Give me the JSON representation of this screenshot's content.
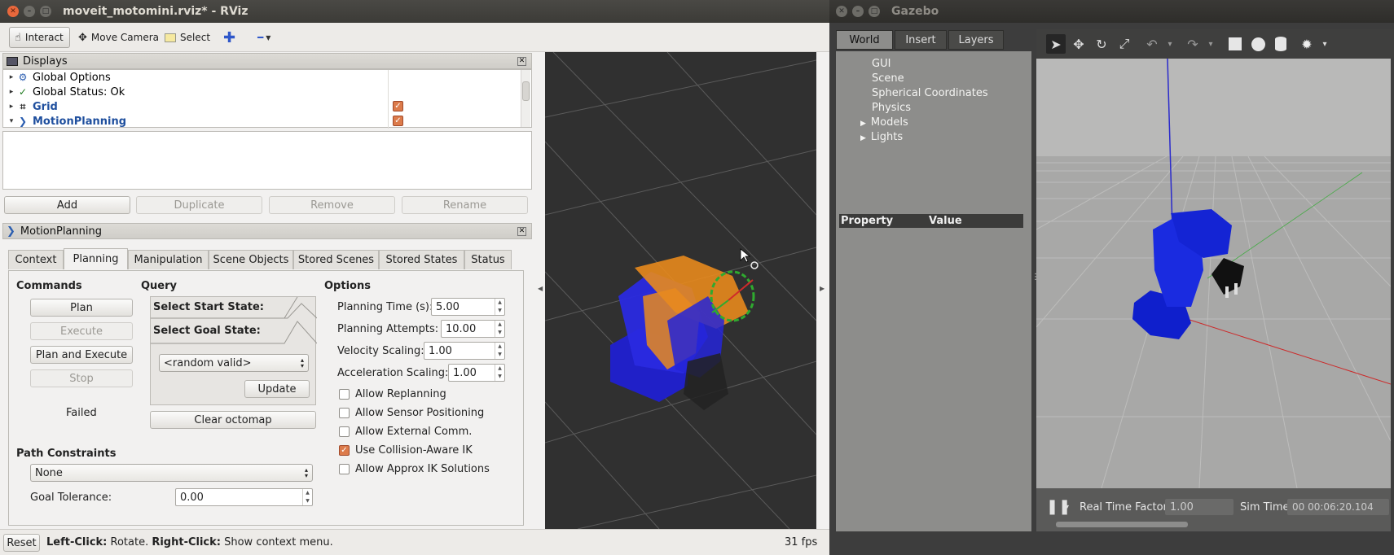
{
  "rviz": {
    "window_title": "moveit_motomini.rviz* - RViz",
    "toolbar": {
      "interact": "Interact",
      "move_camera": "Move Camera",
      "select": "Select"
    },
    "displays": {
      "header": "Displays",
      "items": [
        {
          "label": "Global Options",
          "arrow": "▸"
        },
        {
          "label": "Global Status: Ok",
          "arrow": "▸"
        },
        {
          "label": "Grid",
          "arrow": "▸"
        },
        {
          "label": "MotionPlanning",
          "arrow": "▾"
        }
      ],
      "buttons": {
        "add": "Add",
        "duplicate": "Duplicate",
        "remove": "Remove",
        "rename": "Rename"
      }
    },
    "motion_planning": {
      "header": "MotionPlanning",
      "tabs": [
        "Context",
        "Planning",
        "Manipulation",
        "Scene Objects",
        "Stored Scenes",
        "Stored States",
        "Status"
      ],
      "commands": {
        "title": "Commands",
        "plan": "Plan",
        "execute": "Execute",
        "plan_and_execute": "Plan and Execute",
        "stop": "Stop",
        "result": "Failed"
      },
      "query": {
        "title": "Query",
        "start_state": "Select Start State:",
        "goal_state": "Select Goal State:",
        "goal_value": "<random valid>",
        "update": "Update",
        "clear_octomap": "Clear octomap"
      },
      "options": {
        "title": "Options",
        "planning_time_label": "Planning Time (s):",
        "planning_time": "5.00",
        "planning_attempts_label": "Planning Attempts:",
        "planning_attempts": "10.00",
        "velocity_scaling_label": "Velocity Scaling:",
        "velocity_scaling": "1.00",
        "acceleration_scaling_label": "Acceleration Scaling:",
        "acceleration_scaling": "1.00",
        "checkboxes": [
          {
            "label": "Allow Replanning",
            "checked": false
          },
          {
            "label": "Allow Sensor Positioning",
            "checked": false
          },
          {
            "label": "Allow External Comm.",
            "checked": false
          },
          {
            "label": "Use Collision-Aware IK",
            "checked": true
          },
          {
            "label": "Allow Approx IK Solutions",
            "checked": false
          }
        ]
      },
      "path_constraints": {
        "title": "Path Constraints",
        "value": "None",
        "goal_tolerance_label": "Goal Tolerance:",
        "goal_tolerance": "0.00"
      }
    },
    "status": {
      "reset": "Reset",
      "hint_left_key": "Left-Click:",
      "hint_left": " Rotate. ",
      "hint_right_key": "Right-Click:",
      "hint_right": " Show context menu.",
      "fps": "31 fps"
    }
  },
  "gazebo": {
    "window_title": "Gazebo",
    "tabs": [
      "World",
      "Insert",
      "Layers"
    ],
    "tree": [
      "GUI",
      "Scene",
      "Spherical Coordinates",
      "Physics",
      "Models",
      "Lights"
    ],
    "property_header": "Property",
    "value_header": "Value",
    "bottom": {
      "real_time_factor_label": "Real Time Factor:",
      "real_time_factor": "1.00",
      "sim_time_label": "Sim Time:",
      "sim_time": "00 00:06:20.104"
    }
  },
  "colors": {
    "accent_orange": "#dc7b4b",
    "robot_blue": "#1f2fd6",
    "robot_orange": "#e8891d",
    "viewport_bg": "#303030",
    "gazebo_sky": "#b7b7b6"
  }
}
